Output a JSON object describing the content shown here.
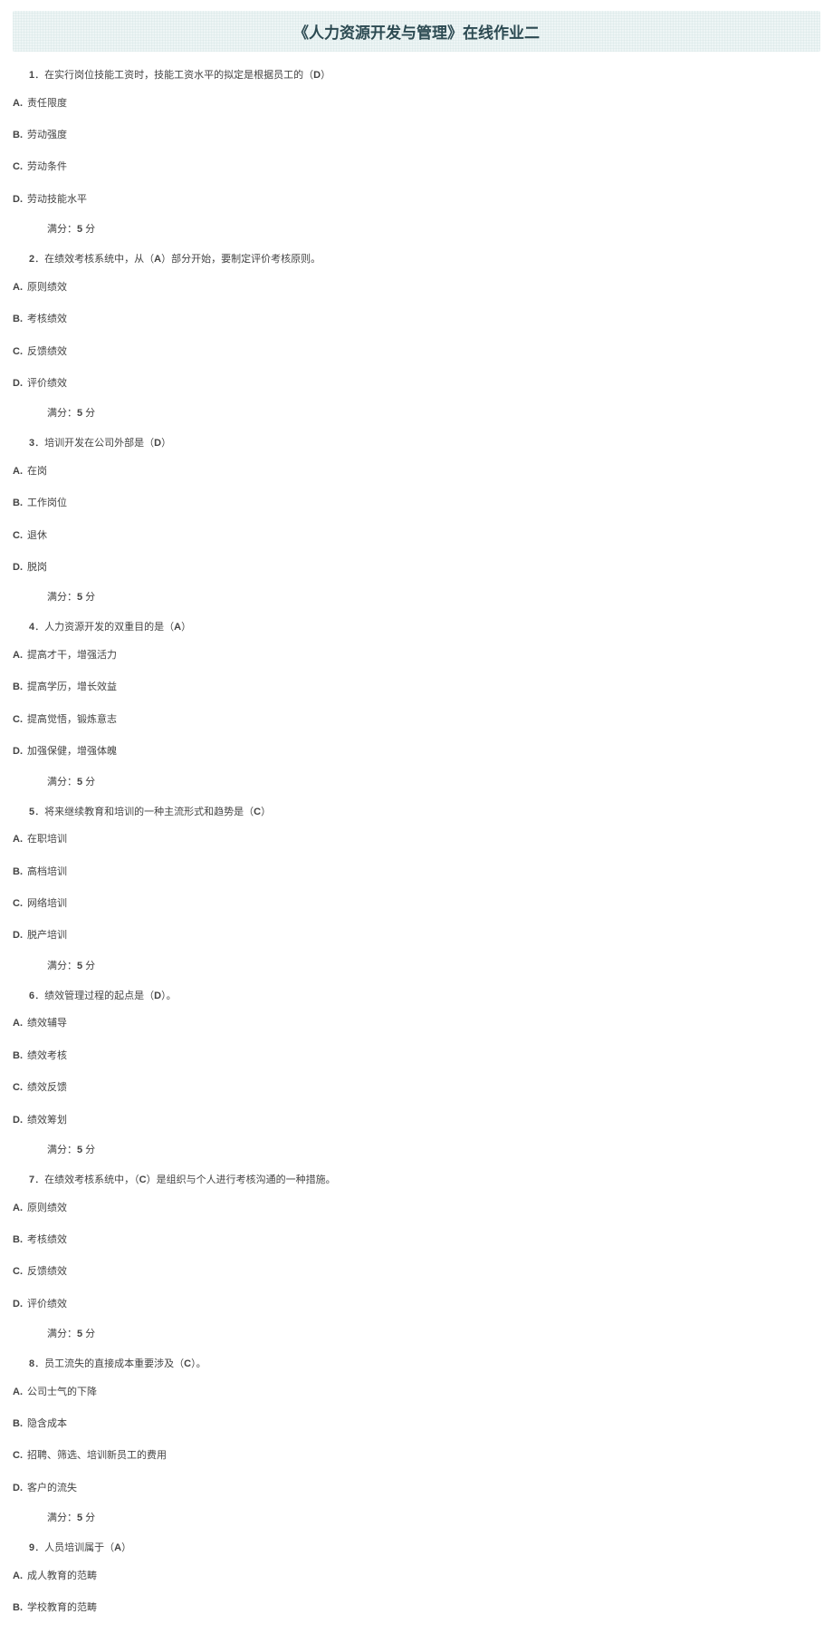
{
  "title": "《人力资源开发与管理》在线作业二",
  "score_label_prefix": "满分：",
  "score_label_suffix": " 分",
  "questions": [
    {
      "num": "1",
      "text_before": "．在实行岗位技能工资时，技能工资水平的拟定是根据员工的（",
      "answer": "D",
      "text_after": "）",
      "options": [
        "责任限度",
        "劳动强度",
        "劳动条件",
        "劳动技能水平"
      ],
      "score": "5"
    },
    {
      "num": "2",
      "text_before": "．在绩效考核系统中，从（",
      "answer": "A",
      "text_after": "）部分开始，要制定评价考核原则。",
      "options": [
        "原则绩效",
        "考核绩效",
        "反馈绩效",
        "评价绩效"
      ],
      "score": "5"
    },
    {
      "num": "3",
      "text_before": "．培训开发在公司外部是（",
      "answer": "D",
      "text_after": "）",
      "options": [
        "在岗",
        "工作岗位",
        "退休",
        "脱岗"
      ],
      "score": "5"
    },
    {
      "num": "4",
      "text_before": "．人力资源开发的双重目的是（",
      "answer": "A",
      "text_after": "）",
      "options": [
        "提高才干，增强活力",
        "提高学历，增长效益",
        "提高觉悟，锻炼意志",
        "加强保健，增强体魄"
      ],
      "score": "5"
    },
    {
      "num": "5",
      "text_before": "．将来继续教育和培训的一种主流形式和趋势是（",
      "answer": "C",
      "text_after": "）",
      "options": [
        "在职培训",
        "高档培训",
        "网络培训",
        "脱产培训"
      ],
      "score": "5"
    },
    {
      "num": "6",
      "text_before": "．绩效管理过程的起点是（",
      "answer": "D",
      "text_after": "）。",
      "options": [
        "绩效辅导",
        "绩效考核",
        "绩效反馈",
        "绩效筹划"
      ],
      "score": "5"
    },
    {
      "num": "7",
      "text_before": "．在绩效考核系统中，（",
      "answer": "C",
      "text_after": "）是组织与个人进行考核沟通的一种措施。",
      "options": [
        "原则绩效",
        "考核绩效",
        "反馈绩效",
        "评价绩效"
      ],
      "score": "5"
    },
    {
      "num": "8",
      "text_before": "．员工流失的直接成本重要涉及（",
      "answer": "C",
      "text_after": "）。",
      "options": [
        "公司士气的下降",
        "隐含成本",
        "招聘、筛选、培训新员工的费用",
        "客户的流失"
      ],
      "score": "5"
    },
    {
      "num": "9",
      "text_before": "．人员培训属于（",
      "answer": "A",
      "text_after": "）",
      "options": [
        "成人教育的范畴",
        "学校教育的范畴"
      ],
      "score": "5",
      "hide_score": true
    }
  ],
  "option_letters": [
    "A",
    "B",
    "C",
    "D"
  ]
}
